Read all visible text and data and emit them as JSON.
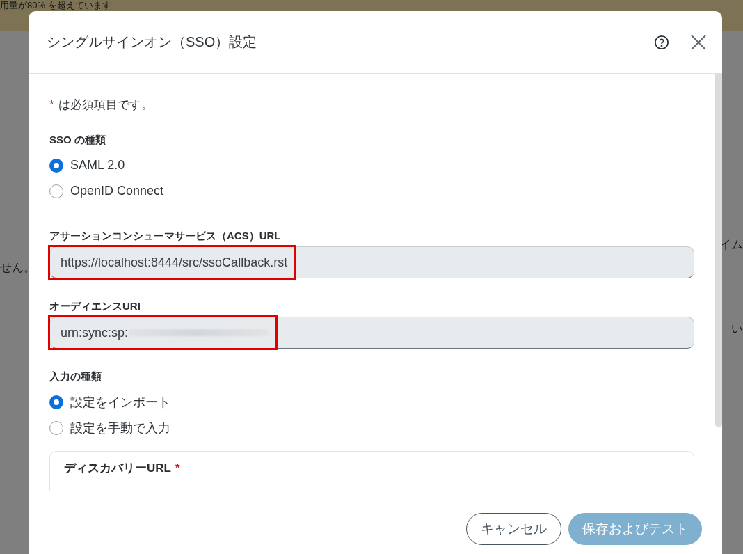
{
  "background": {
    "banner": "用量が80% を超えています",
    "left_texts": [
      "せん。"
    ],
    "right_texts": [
      "イム",
      "い"
    ]
  },
  "dialog": {
    "title": "シングルサインオン（SSO）設定",
    "required_note": {
      "mark": "*",
      "text": "は必須項目です。"
    },
    "sections": [
      {
        "kind": "radio_group",
        "label": "SSO の種類",
        "options": [
          {
            "label": "SAML 2.0",
            "selected": true
          },
          {
            "label": "OpenID Connect",
            "selected": false
          }
        ]
      },
      {
        "kind": "field",
        "label": "アサーションコンシューマサービス（ACS）URL",
        "value": "https://localhost:8444/src/ssoCallback.rst",
        "highlighted": true,
        "redacted": false
      },
      {
        "kind": "field",
        "label": "オーディエンスURI",
        "value": "urn:sync:sp:",
        "highlighted": true,
        "redacted": true
      },
      {
        "kind": "radio_group",
        "label": "入力の種類",
        "options": [
          {
            "label": "設定をインポート",
            "selected": true
          },
          {
            "label": "設定を手動で入力",
            "selected": false
          }
        ]
      },
      {
        "kind": "card",
        "label": "ディスカバリーURL",
        "required": true
      }
    ],
    "buttons": [
      {
        "label": "キャンセル",
        "kind": "secondary",
        "disabled": false
      },
      {
        "label": "保存およびテスト",
        "kind": "primary",
        "disabled": true
      }
    ]
  }
}
